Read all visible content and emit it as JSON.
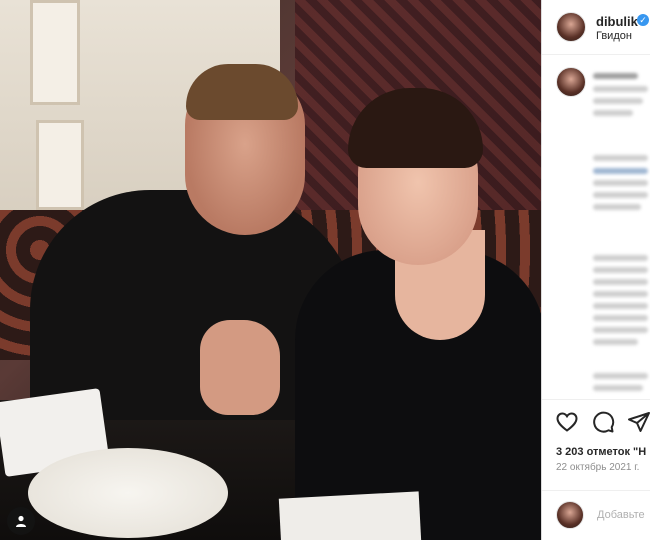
{
  "post": {
    "username": "dibulik",
    "location": "Гвидон",
    "likes_text": "3 203 отметок \"Н",
    "date_text": "22 октябрь 2021 г.",
    "comment_placeholder": "Добавьте"
  },
  "icons": {
    "verified": "verified-badge-icon",
    "like": "heart-icon",
    "comment": "comment-icon",
    "share": "paper-plane-icon",
    "tagged_user": "user-icon"
  },
  "colors": {
    "verified": "#3897f0",
    "text": "#262626",
    "muted": "#8e8e8e"
  }
}
